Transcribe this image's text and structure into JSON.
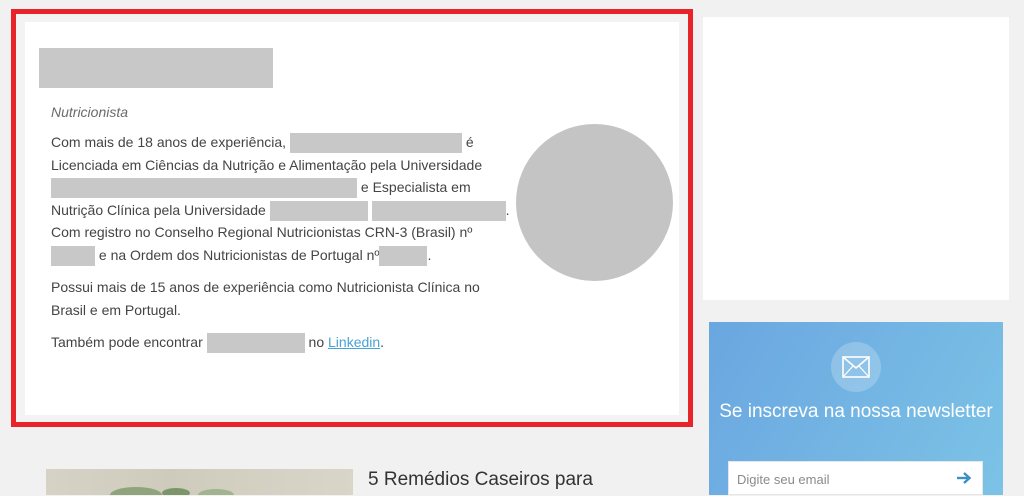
{
  "author": {
    "role": "Nutricionista",
    "bio": {
      "p1_a": "Com mais de 18 anos de experiência,",
      "p1_b": "é Licenciada em Ciências da Nutrição e Alimentação pela Universidade",
      "p1_c": "e Especialista em Nutrição Clínica pela Universidade",
      "p1_d": ". Com registro no Conselho Regional Nutricionistas CRN-3 (Brasil) nº",
      "p1_e": "e na Ordem dos Nutricionistas de Portugal nº",
      "p1_f": ".",
      "p2": "Possui mais de 15 anos de experiência como Nutricionista Clínica no Brasil e em Portugal.",
      "p3_a": "Também pode encontrar",
      "p3_b": "no",
      "link_label": "Linkedin",
      "p3_end": "."
    },
    "frame_color": "#e8232a"
  },
  "newsletter": {
    "title": "Se inscreva na nossa newsletter",
    "email_placeholder": "Digite seu email",
    "icon": "envelope-icon",
    "submit_icon": "arrow-right-icon",
    "accent": "#6aa6e0"
  },
  "article": {
    "title": "5 Remédios Caseiros para"
  }
}
